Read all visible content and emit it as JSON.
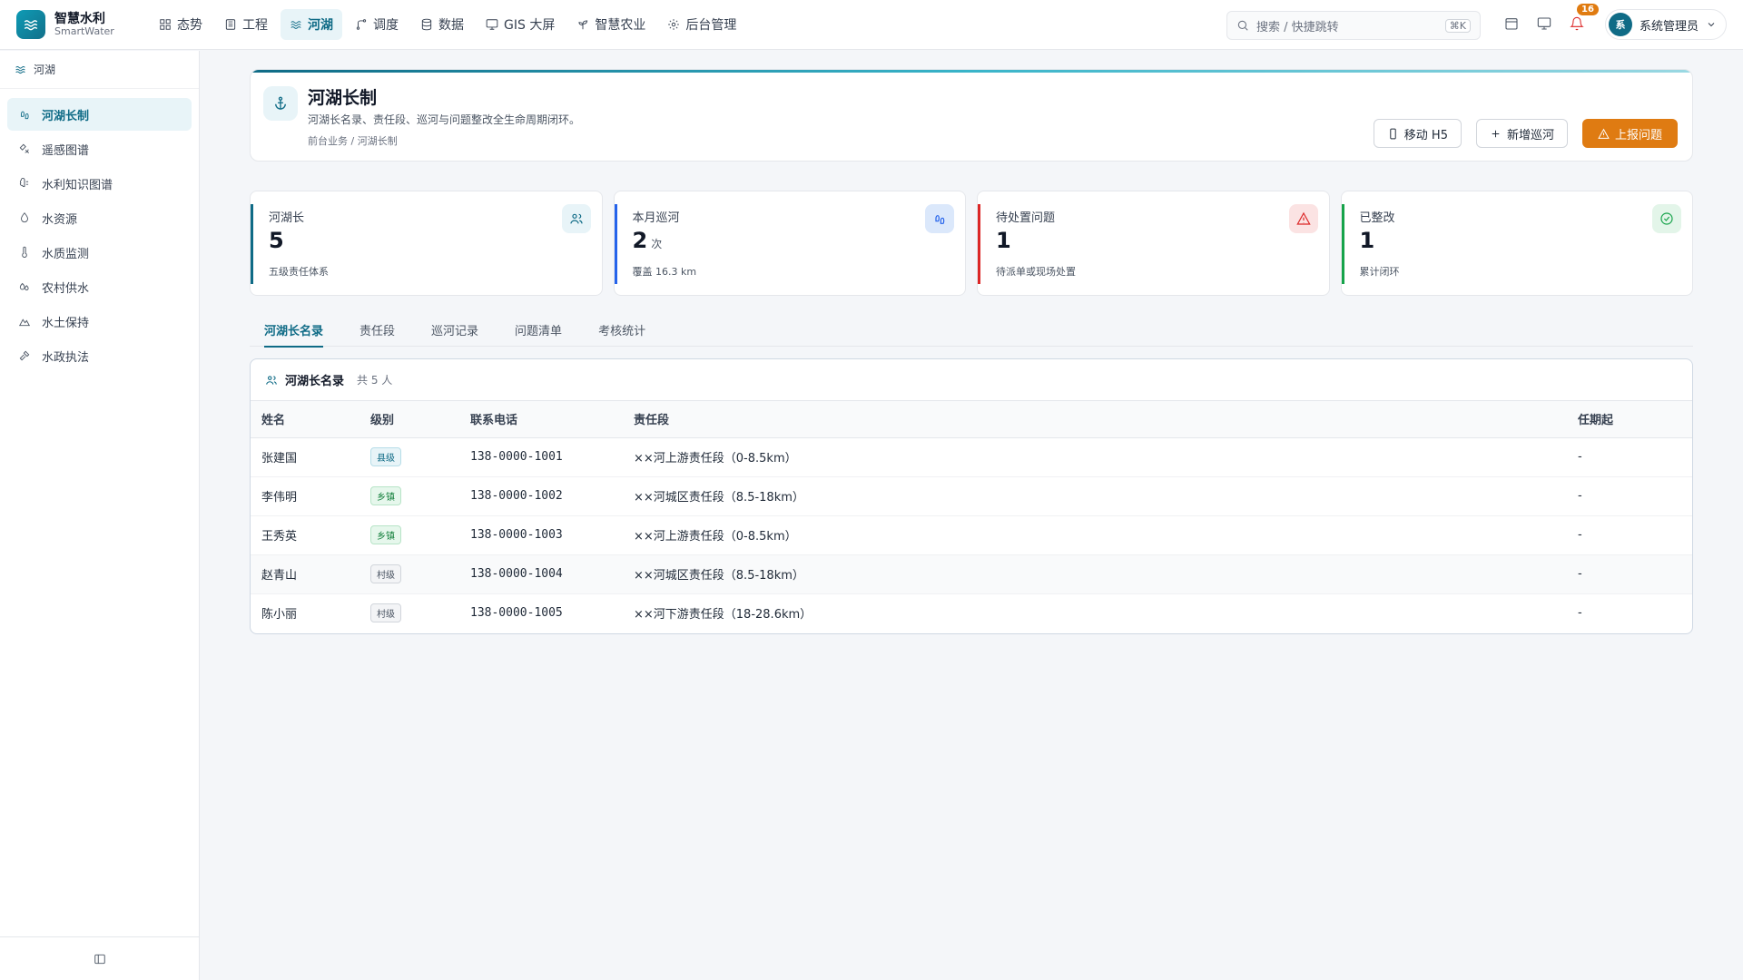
{
  "brand": {
    "name": "智慧水利",
    "sub": "SmartWater"
  },
  "nav": [
    {
      "label": "态势",
      "icon": "grid-icon"
    },
    {
      "label": "工程",
      "icon": "building-icon"
    },
    {
      "label": "河湖",
      "icon": "waves-icon",
      "active": true
    },
    {
      "label": "调度",
      "icon": "route-icon"
    },
    {
      "label": "数据",
      "icon": "database-icon"
    },
    {
      "label": "GIS 大屏",
      "icon": "monitor-icon"
    },
    {
      "label": "智慧农业",
      "icon": "sprout-icon"
    },
    {
      "label": "后台管理",
      "icon": "gear-icon"
    }
  ],
  "search": {
    "placeholder": "搜索 / 快捷跳转",
    "shortcut": "⌘K"
  },
  "notifications": {
    "count": "16"
  },
  "user": {
    "avatar": "系",
    "name": "系统管理员"
  },
  "sidebar": {
    "section": "河湖",
    "items": [
      {
        "label": "河湖长制",
        "active": true
      },
      {
        "label": "遥感图谱"
      },
      {
        "label": "水利知识图谱"
      },
      {
        "label": "水资源"
      },
      {
        "label": "水质监测"
      },
      {
        "label": "农村供水"
      },
      {
        "label": "水土保持"
      },
      {
        "label": "水政执法"
      }
    ]
  },
  "header": {
    "title": "河湖长制",
    "desc": "河湖长名录、责任段、巡河与问题整改全生命周期闭环。",
    "crumb": "前台业务 / 河湖长制",
    "actions": {
      "mobile": "移动 H5",
      "add_patrol": "新增巡河",
      "report": "上报问题"
    }
  },
  "stats": [
    {
      "label": "河湖长",
      "value": "5",
      "unit": "",
      "sub": "五级责任体系",
      "color": "#0f6b86",
      "icon_bg": "#e8f4f8",
      "icon_color": "#0f6b86"
    },
    {
      "label": "本月巡河",
      "value": "2",
      "unit": "次",
      "sub": "覆盖 16.3 km",
      "color": "#2563eb",
      "icon_bg": "#dbe8fb",
      "icon_color": "#2563eb"
    },
    {
      "label": "待处置问题",
      "value": "1",
      "unit": "",
      "sub": "待派单或现场处置",
      "color": "#dc2626",
      "icon_bg": "#fbe3e3",
      "icon_color": "#dc2626"
    },
    {
      "label": "已整改",
      "value": "1",
      "unit": "",
      "sub": "累计闭环",
      "color": "#16a34a",
      "icon_bg": "#e3f5e9",
      "icon_color": "#16a34a"
    }
  ],
  "tabs": [
    {
      "label": "河湖长名录",
      "active": true
    },
    {
      "label": "责任段"
    },
    {
      "label": "巡河记录"
    },
    {
      "label": "问题清单"
    },
    {
      "label": "考核统计"
    }
  ],
  "table": {
    "title": "河湖长名录",
    "count": "共 5 人",
    "columns": [
      "姓名",
      "级别",
      "联系电话",
      "责任段",
      "任期起"
    ],
    "rows": [
      {
        "name": "张建国",
        "level": "县级",
        "level_type": "county",
        "phone": "138-0000-1001",
        "segment": "××河上游责任段（0-8.5km）",
        "start": "-"
      },
      {
        "name": "李伟明",
        "level": "乡镇",
        "level_type": "town",
        "phone": "138-0000-1002",
        "segment": "××河城区责任段（8.5-18km）",
        "start": "-"
      },
      {
        "name": "王秀英",
        "level": "乡镇",
        "level_type": "town",
        "phone": "138-0000-1003",
        "segment": "××河上游责任段（0-8.5km）",
        "start": "-"
      },
      {
        "name": "赵青山",
        "level": "村级",
        "level_type": "village",
        "phone": "138-0000-1004",
        "segment": "××河城区责任段（8.5-18km）",
        "start": "-"
      },
      {
        "name": "陈小丽",
        "level": "村级",
        "level_type": "village",
        "phone": "138-0000-1005",
        "segment": "××河下游责任段（18-28.6km）",
        "start": "-"
      }
    ]
  }
}
